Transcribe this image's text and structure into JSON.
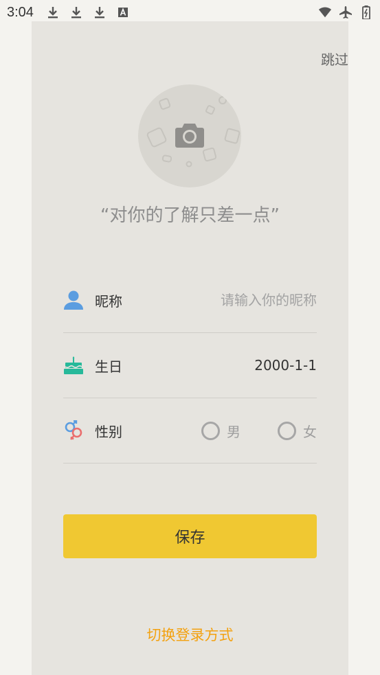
{
  "status_bar": {
    "time": "3:04",
    "left_icons": [
      "download-icon",
      "download-icon",
      "download-icon",
      "text-a-icon"
    ],
    "right_icons": [
      "wifi-icon",
      "airplane-icon",
      "battery-icon"
    ]
  },
  "header": {
    "skip_label": "跳过"
  },
  "avatar": {
    "icon": "camera-icon"
  },
  "slogan": "“对你的了解只差一点”",
  "form": {
    "nickname": {
      "label": "昵称",
      "placeholder": "请输入你的昵称",
      "value": "",
      "icon": "user-icon"
    },
    "birthday": {
      "label": "生日",
      "value": "2000-1-1",
      "icon": "cake-icon"
    },
    "gender": {
      "label": "性别",
      "icon": "gender-icon",
      "options": [
        "男",
        "女"
      ],
      "selected": null
    }
  },
  "actions": {
    "save_label": "保存",
    "switch_login_label": "切换登录方式"
  },
  "colors": {
    "accent": "#f0c832",
    "link": "#f3a10f",
    "panel_bg": "#e6e4df",
    "user_icon": "#5b9de0",
    "cake_icon": "#27b99a"
  }
}
